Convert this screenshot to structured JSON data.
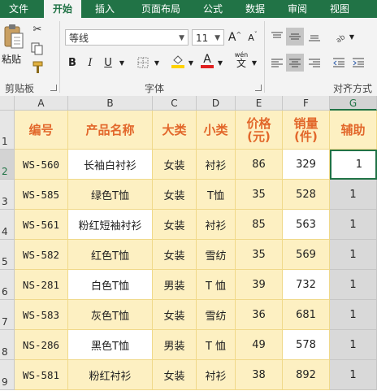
{
  "menu": {
    "tabs": [
      "文件",
      "开始",
      "插入",
      "页面布局",
      "公式",
      "数据",
      "审阅",
      "视图"
    ]
  },
  "ribbon": {
    "paste_label": "粘贴",
    "clipboard_label": "剪贴板",
    "font_label": "字体",
    "font_name": "等线",
    "font_size": "11",
    "bold": "B",
    "italic": "I",
    "underline": "U",
    "font_color_letter": "A",
    "wen_label": "wén",
    "wen_char": "文",
    "align_label": "对齐方式",
    "grow_font": "A",
    "shrink_font": "A"
  },
  "sheet": {
    "columns": [
      "A",
      "B",
      "C",
      "D",
      "E",
      "F",
      "G"
    ],
    "rows": [
      "1",
      "2",
      "3",
      "4",
      "5",
      "6",
      "7",
      "8",
      "9"
    ],
    "headers": [
      "编号",
      "产品名称",
      "大类",
      "小类",
      "价格\n(元)",
      "销量\n(件)",
      "辅助"
    ],
    "data": [
      [
        "WS-560",
        "长袖白衬衫",
        "女装",
        "衬衫",
        "86",
        "329",
        "1"
      ],
      [
        "WS-585",
        "绿色T恤",
        "女装",
        "T恤",
        "35",
        "528",
        "1"
      ],
      [
        "WS-561",
        "粉红短袖衬衫",
        "女装",
        "衬衫",
        "85",
        "563",
        "1"
      ],
      [
        "WS-582",
        "红色T恤",
        "女装",
        "雪纺",
        "35",
        "569",
        "1"
      ],
      [
        "NS-281",
        "白色T恤",
        "男装",
        "T 恤",
        "39",
        "732",
        "1"
      ],
      [
        "WS-583",
        "灰色T恤",
        "女装",
        "雪纺",
        "36",
        "681",
        "1"
      ],
      [
        "NS-286",
        "黑色T恤",
        "男装",
        "T 恤",
        "49",
        "578",
        "1"
      ],
      [
        "WS-581",
        "粉红衬衫",
        "女装",
        "衬衫",
        "38",
        "892",
        "1"
      ]
    ]
  },
  "colors": {
    "accent": "#217346",
    "header_text": "#e2672b",
    "fill": "#fdf0c2",
    "aux_fill": "#d9d9d9"
  }
}
